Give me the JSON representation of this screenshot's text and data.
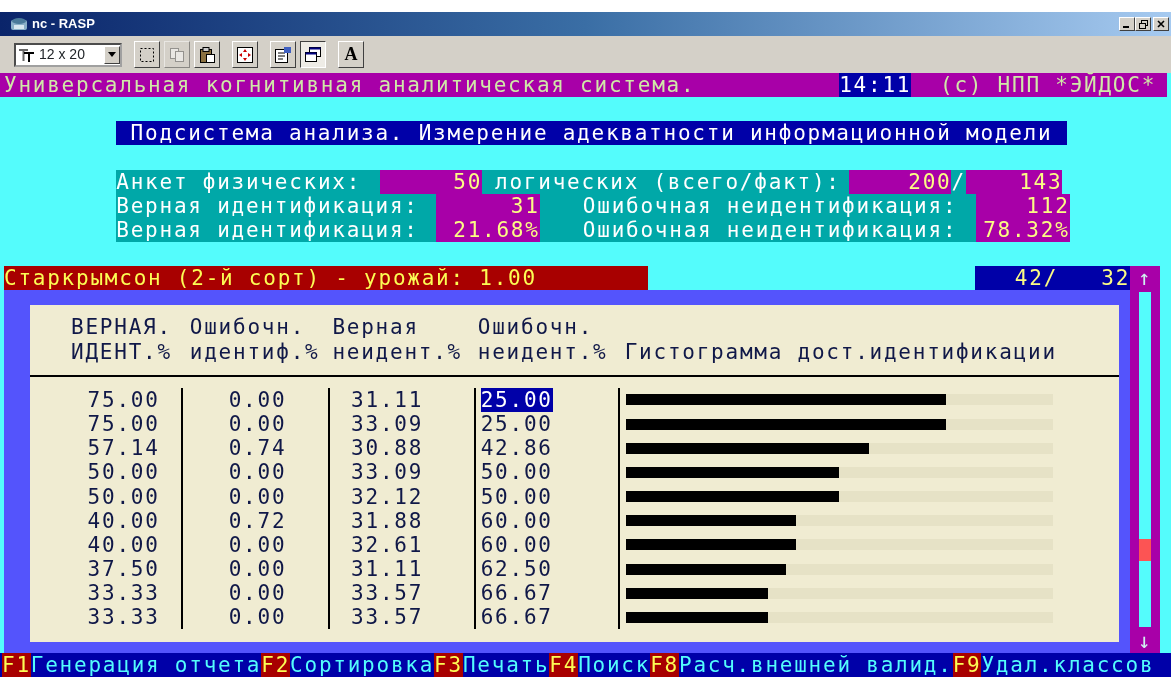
{
  "window": {
    "title": "nc - RASP"
  },
  "toolbar": {
    "font_size": "12 x 20",
    "buttons": [
      {
        "kind": "select",
        "disabled": false,
        "pressed": false
      },
      {
        "kind": "copy",
        "disabled": true,
        "pressed": false
      },
      {
        "kind": "paste",
        "disabled": false,
        "pressed": false
      },
      {
        "kind": "fullscreen",
        "disabled": false,
        "pressed": false
      },
      {
        "kind": "properties",
        "disabled": false,
        "pressed": false
      },
      {
        "kind": "window",
        "disabled": false,
        "pressed": true
      },
      {
        "kind": "font",
        "label": "A",
        "disabled": false,
        "pressed": false
      }
    ]
  },
  "header": {
    "title": "Универсальная когнитивная аналитическая система.",
    "time": "14:11",
    "copyright": "(c) НПП *ЭЙДОС*"
  },
  "subsystem_title": "Подсистема анализа. Измерение адекватности информационной модели",
  "stats": [
    {
      "cells": [
        {
          "kind": "label",
          "text": "Анкет физических:"
        },
        {
          "kind": "value",
          "text": "50"
        },
        {
          "kind": "label",
          "text": "логических (всего/факт):"
        },
        {
          "kind": "value",
          "text": "200"
        },
        {
          "kind": "label",
          "text": "/"
        },
        {
          "kind": "value",
          "text": "143"
        }
      ]
    },
    {
      "cells": [
        {
          "kind": "label",
          "text": "Верная идентификация:"
        },
        {
          "kind": "value",
          "text": "31"
        },
        {
          "kind": "label",
          "text": "Ошибочная неидентификация:"
        },
        {
          "kind": "value",
          "text": "112"
        }
      ]
    },
    {
      "cells": [
        {
          "kind": "label",
          "text": "Верная идентификация:"
        },
        {
          "kind": "value",
          "text": "21.68%"
        },
        {
          "kind": "label",
          "text": "Ошибочная неидентификация:"
        },
        {
          "kind": "value",
          "text": "78.32%"
        }
      ]
    }
  ],
  "class_bar": {
    "title": "Старкрымсон (2-й сорт) - урожай: 1.00",
    "position": "42/",
    "count": "32"
  },
  "scrollbar": {
    "up_arrow": "↑",
    "down_arrow": "↓"
  },
  "table": {
    "columns": [
      {
        "line_1": "ВЕРНАЯ.",
        "line_2": "ИДЕНТ.%"
      },
      {
        "line_1": "Ошибочн.",
        "line_2": "идентиф.%"
      },
      {
        "line_1": "Верная",
        "line_2": "неидент.%"
      },
      {
        "line_1": "Ошибочн.",
        "line_2": "неидент.%"
      },
      {
        "line_2": "Гистограмма дост.идентификации"
      }
    ],
    "rows": [
      {
        "cells": [
          "75.00",
          "0.00",
          "31.11",
          "25.00"
        ],
        "level": 0.75,
        "selected": true
      },
      {
        "cells": [
          "75.00",
          "0.00",
          "33.09",
          "25.00"
        ],
        "level": 0.75,
        "selected": false
      },
      {
        "cells": [
          "57.14",
          "0.74",
          "30.88",
          "42.86"
        ],
        "level": 0.5714,
        "selected": false
      },
      {
        "cells": [
          "50.00",
          "0.00",
          "33.09",
          "50.00"
        ],
        "level": 0.5,
        "selected": false
      },
      {
        "cells": [
          "50.00",
          "0.00",
          "32.12",
          "50.00"
        ],
        "level": 0.5,
        "selected": false
      },
      {
        "cells": [
          "40.00",
          "0.72",
          "31.88",
          "60.00"
        ],
        "level": 0.4,
        "selected": false
      },
      {
        "cells": [
          "40.00",
          "0.00",
          "32.61",
          "60.00"
        ],
        "level": 0.4,
        "selected": false
      },
      {
        "cells": [
          "37.50",
          "0.00",
          "31.11",
          "62.50"
        ],
        "level": 0.375,
        "selected": false
      },
      {
        "cells": [
          "33.33",
          "0.00",
          "33.57",
          "66.67"
        ],
        "level": 0.3333,
        "selected": false
      },
      {
        "cells": [
          "33.33",
          "0.00",
          "33.57",
          "66.67"
        ],
        "level": 0.3333,
        "selected": false
      }
    ]
  },
  "function_keys": [
    {
      "key": "F1",
      "label": "Генерация отчета"
    },
    {
      "key": "F2",
      "label": "Сортировка"
    },
    {
      "key": "F3",
      "label": "Печать"
    },
    {
      "key": "F4",
      "label": "Поиск"
    },
    {
      "key": "F8",
      "label": "Расч.внешней валид."
    },
    {
      "key": "F9",
      "label": "Удал.классов"
    }
  ]
}
